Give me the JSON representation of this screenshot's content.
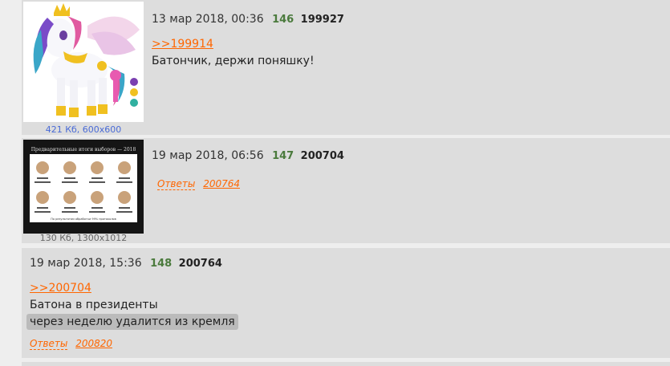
{
  "posts": [
    {
      "date": "13 мар 2018, 00:36",
      "number": "146",
      "id": "199927",
      "thumb_meta": "421 Кб, 600x600",
      "reply_to": ">>199914",
      "lines": [
        "Батончик, держи поняшку!"
      ]
    },
    {
      "date": "19 мар 2018, 06:56",
      "number": "147",
      "id": "200704",
      "thumb_meta": "130 Кб, 1300x1012",
      "answers_label": "Ответы",
      "answers": [
        "200764"
      ],
      "thumb_title": "Предварительные итоги выборов — 2018",
      "thumb_footer": "По результатам обработки 99% протоколов"
    },
    {
      "date": "19 мар 2018, 15:36",
      "number": "148",
      "id": "200764",
      "reply_to": ">>200704",
      "lines": [
        "Батона в президенты"
      ],
      "spoiler": "через неделю удалится из кремля",
      "answers_label": "Ответы",
      "answers": [
        "200820"
      ]
    }
  ],
  "colors": {
    "page_bg": "#eeeeee",
    "post_bg": "#dddddd",
    "link": "#ff6600",
    "post_number": "#4a7a3c"
  }
}
